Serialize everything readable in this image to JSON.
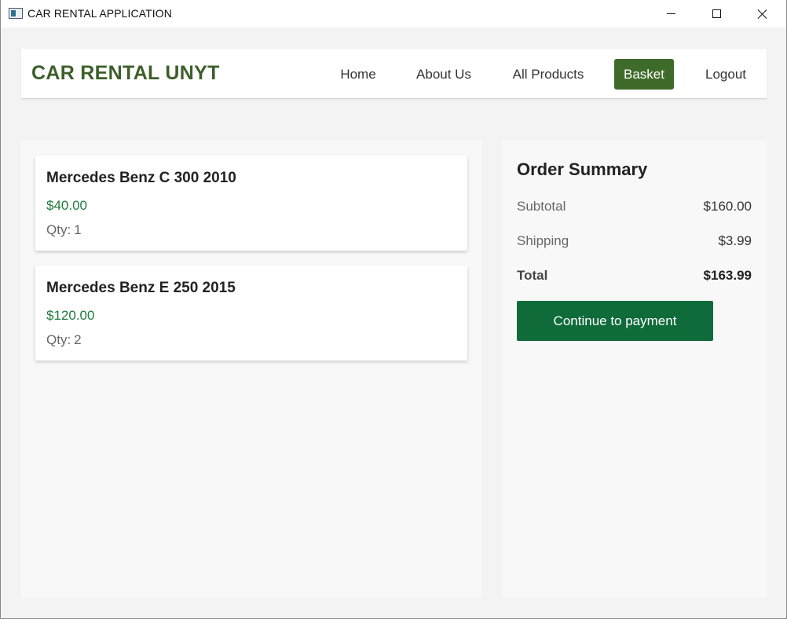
{
  "window": {
    "title": "CAR RENTAL APPLICATION"
  },
  "navbar": {
    "brand": "CAR RENTAL UNYT",
    "links": [
      {
        "label": "Home"
      },
      {
        "label": "About Us"
      },
      {
        "label": "All Products"
      },
      {
        "label": "Basket",
        "active": true
      },
      {
        "label": "Logout"
      }
    ]
  },
  "cart": {
    "items": [
      {
        "name": "Mercedes Benz C 300 2010",
        "price": "$40.00",
        "qty_label": "Qty:",
        "qty": "1"
      },
      {
        "name": "Mercedes Benz E 250 2015",
        "price": "$120.00",
        "qty_label": "Qty:",
        "qty": "2"
      }
    ]
  },
  "summary": {
    "title": "Order Summary",
    "subtotal_label": "Subtotal",
    "subtotal_value": "$160.00",
    "shipping_label": "Shipping",
    "shipping_value": "$3.99",
    "total_label": "Total",
    "total_value": "$163.99",
    "pay_button": "Continue to payment"
  },
  "colors": {
    "brand": "#3d5f2a",
    "active_nav": "#3f6b2a",
    "price": "#1f7a3e",
    "pay_button": "#0f6b3a"
  },
  "icons": {
    "app": "app-icon",
    "minimize": "minimize-icon",
    "maximize": "maximize-icon",
    "close": "close-icon"
  }
}
